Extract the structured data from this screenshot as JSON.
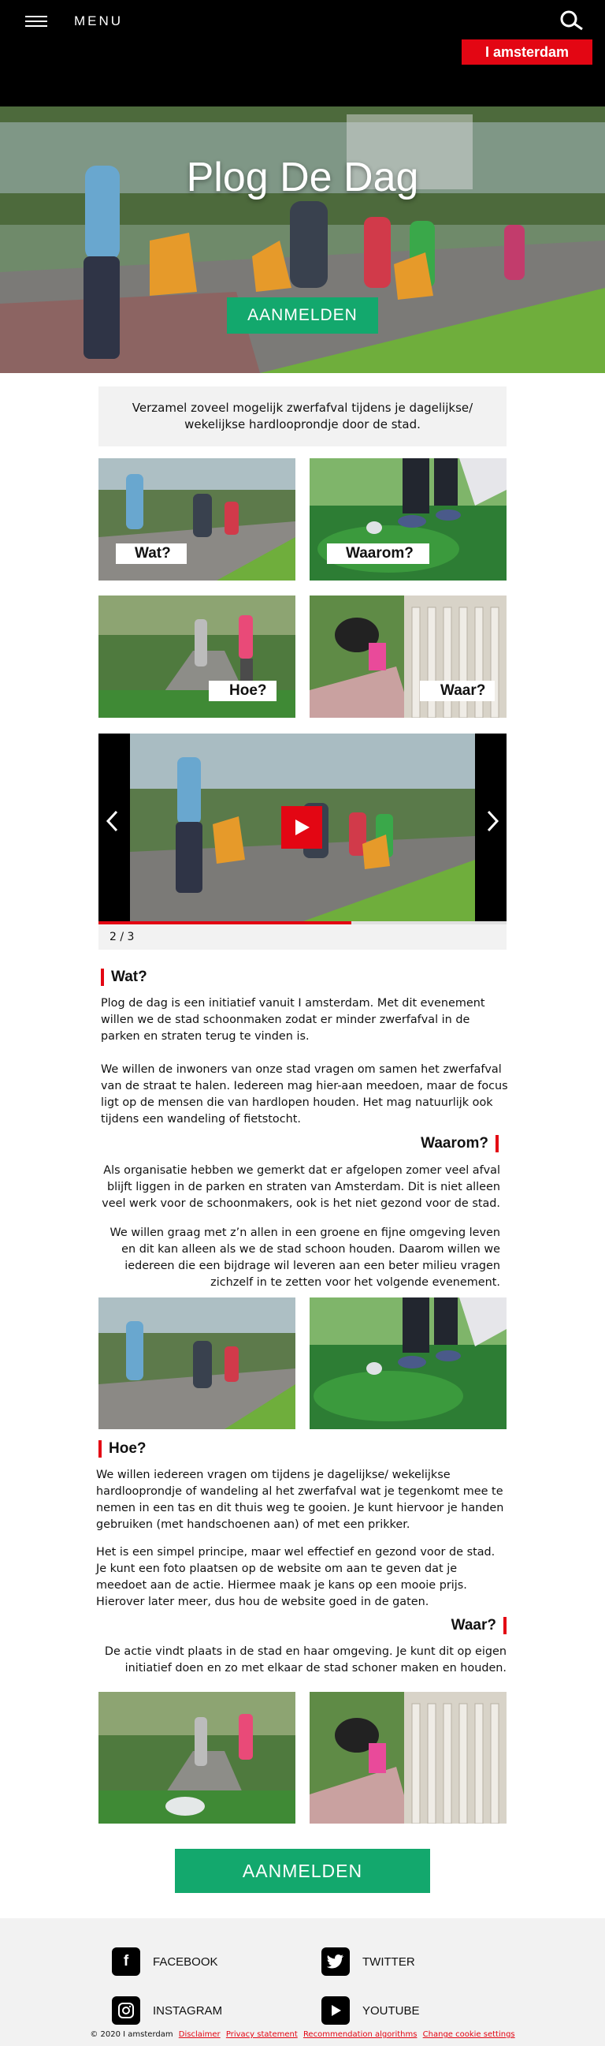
{
  "header": {
    "menu_label": "MENU",
    "brand_prefix": "I",
    "brand_name": "amsterdam"
  },
  "hero": {
    "title": "Plog De Dag",
    "button_label": "AANMELDEN"
  },
  "intro": {
    "text": "Verzamel zoveel mogelijk zwerfafval tijdens je dagelijkse/ wekelijkse hardlooprondje door de stad."
  },
  "tiles": [
    {
      "label": "Wat?"
    },
    {
      "label": "Waarom?"
    },
    {
      "label": "Hoe?"
    },
    {
      "label": "Waar?"
    }
  ],
  "carousel": {
    "pager": "2 / 3",
    "progress": 0.62,
    "prev_icon": "chevron-left-icon",
    "next_icon": "chevron-right-icon",
    "play_icon": "play-icon"
  },
  "sections": {
    "wat": {
      "title": "Wat?",
      "paragraphs": [
        "Plog de dag is een initiatief vanuit I amsterdam. Met dit evenement willen we de stad schoonmaken zodat er minder zwerfafval in de parken en straten terug te vinden is.",
        "We willen de inwoners van onze stad vragen om samen het zwerfafval van de straat te halen. Iedereen mag hier-aan meedoen, maar de focus ligt op de mensen die van hardlopen houden. Het mag natuurlijk ook tijdens een wandeling of fietstocht."
      ]
    },
    "waarom": {
      "title": "Waarom?",
      "paragraphs": [
        "Als organisatie hebben we gemerkt dat er afgelopen zomer veel afval blijft liggen in de parken en straten van Amsterdam. Dit is niet alleen veel werk voor de schoonmakers, ook is het niet gezond voor de stad.",
        "We willen graag met z’n allen in een groene en fijne omgeving leven en dit kan alleen als we de stad schoon houden. Daarom willen we iedereen die een bijdrage wil leveren aan een beter milieu vragen zichzelf in te zetten voor het volgende evenement."
      ]
    },
    "hoe": {
      "title": "Hoe?",
      "paragraphs": [
        "We willen iedereen vragen om tijdens je dagelijkse/ wekelijkse hardlooprondje of wandeling al het zwerfafval wat je tegenkomt mee te nemen in een tas en dit thuis weg te gooien. Je kunt hiervoor je handen gebruiken (met handschoenen aan) of met een prikker.",
        "Het is een simpel principe, maar wel effectief en gezond voor de stad. Je kunt een foto plaatsen op de website om aan te geven dat je meedoet aan de actie. Hiermee maak je kans op een mooie prijs. Hierover later meer, dus hou de website goed in de gaten."
      ]
    },
    "waar": {
      "title": "Waar?",
      "paragraphs": [
        "De actie vindt plaats in de stad en haar omgeving. Je kunt dit op eigen initiatief doen en zo met elkaar de stad schoner maken en houden."
      ]
    }
  },
  "cta": {
    "label": "AANMELDEN"
  },
  "footer": {
    "social": [
      {
        "label": "FACEBOOK",
        "icon": "facebook-icon"
      },
      {
        "label": "TWITTER",
        "icon": "twitter-icon"
      },
      {
        "label": "INSTAGRAM",
        "icon": "instagram-icon"
      },
      {
        "label": "YOUTUBE",
        "icon": "youtube-icon"
      }
    ],
    "copyright": "© 2020 I amsterdam",
    "links": [
      "Disclaimer",
      "Privacy statement",
      "Recommendation algorithms",
      "Change cookie settings"
    ]
  },
  "colors": {
    "accent_red": "#e30613",
    "cta_green": "#13a86d",
    "header_bg": "#000000"
  }
}
